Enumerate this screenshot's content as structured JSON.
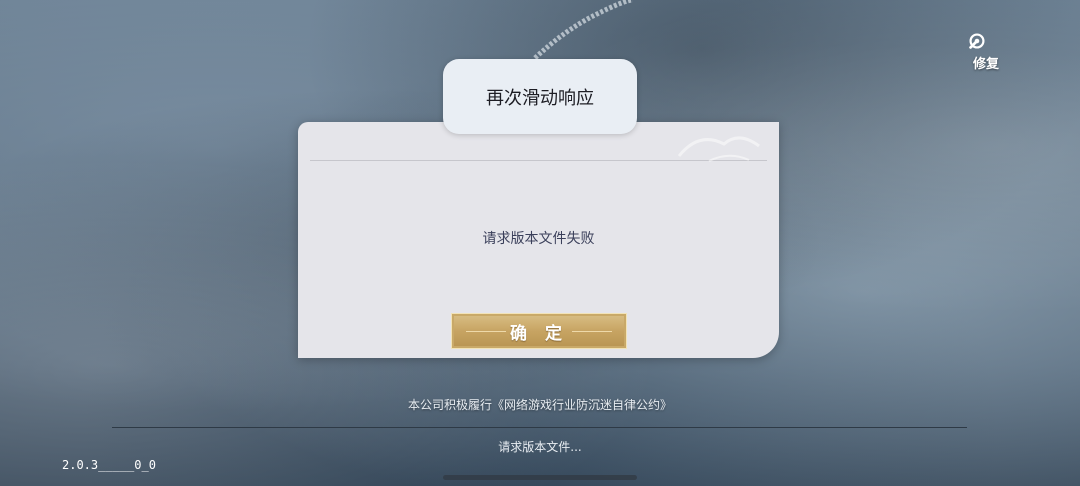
{
  "fix_button": {
    "label": "修复",
    "icon": "wrench-gear-icon"
  },
  "dialog": {
    "title": "再次滑动响应",
    "message": "请求版本文件失败",
    "confirm_label": "确 定"
  },
  "footer": {
    "notice": "本公司积极履行《网络游戏行业防沉迷自律公约》",
    "status": "请求版本文件...",
    "version": "2.0.3_____0_0"
  },
  "colors": {
    "dialog_bg": "#e5e5ea",
    "button_gold": "#c7a463",
    "message_text": "#3a3f5a"
  }
}
